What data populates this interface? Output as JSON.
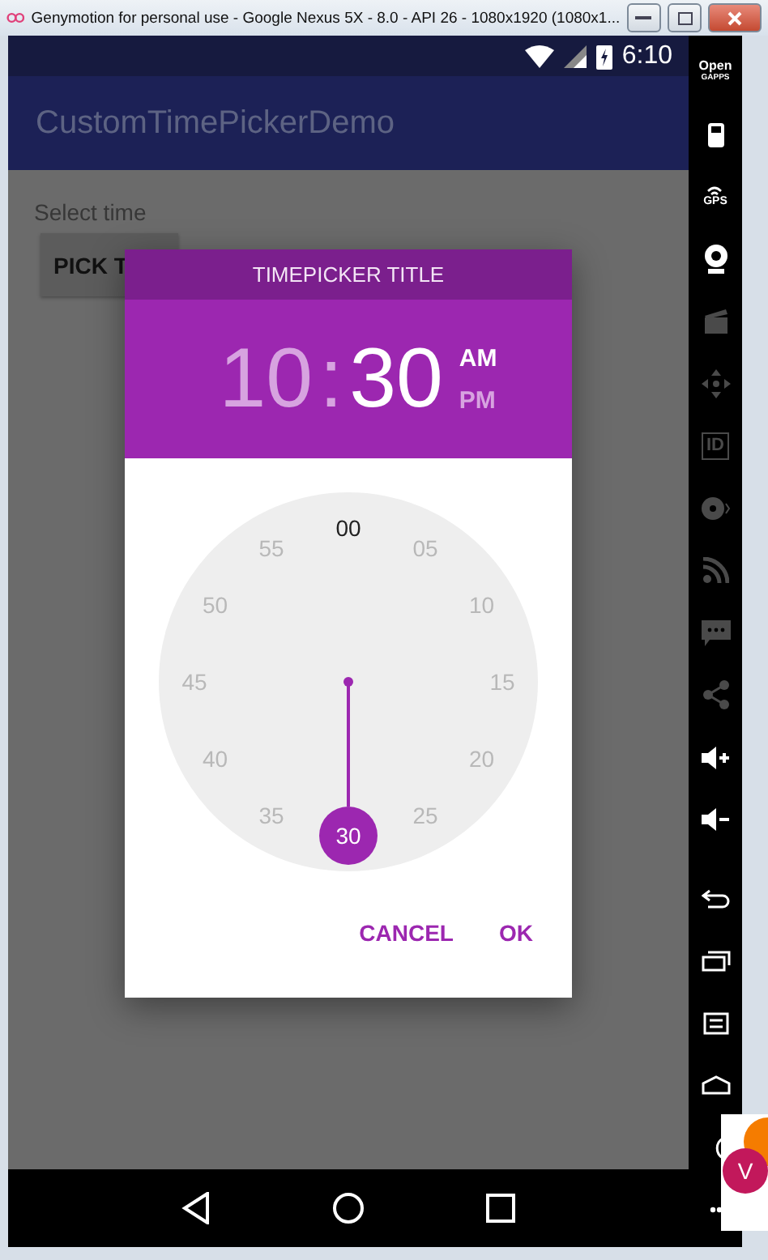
{
  "window": {
    "title": "Genymotion for personal use - Google Nexus 5X - 8.0 - API 26 - 1080x1920 (1080x1..."
  },
  "status_bar": {
    "time": "6:10"
  },
  "app_bar": {
    "title": "CustomTimePickerDemo"
  },
  "content": {
    "label": "Select time",
    "button": "PICK T"
  },
  "dialog": {
    "title": "TIMEPICKER TITLE",
    "hour": {
      "text": "10",
      "selected": false
    },
    "separator": ":",
    "minute": {
      "text": "30",
      "selected": true
    },
    "periods": [
      {
        "label": "AM",
        "selected": true
      },
      {
        "label": "PM",
        "selected": false
      }
    ],
    "dial": [
      {
        "label": "00",
        "selected": false,
        "dim": false
      },
      {
        "label": "05",
        "selected": false,
        "dim": true
      },
      {
        "label": "10",
        "selected": false,
        "dim": true
      },
      {
        "label": "15",
        "selected": false,
        "dim": true
      },
      {
        "label": "20",
        "selected": false,
        "dim": true
      },
      {
        "label": "25",
        "selected": false,
        "dim": true
      },
      {
        "label": "30",
        "selected": true,
        "dim": false
      },
      {
        "label": "35",
        "selected": false,
        "dim": true
      },
      {
        "label": "40",
        "selected": false,
        "dim": true
      },
      {
        "label": "45",
        "selected": false,
        "dim": true
      },
      {
        "label": "50",
        "selected": false,
        "dim": true
      },
      {
        "label": "55",
        "selected": false,
        "dim": true
      }
    ],
    "buttons": [
      "CANCEL",
      "OK"
    ]
  },
  "sidebar": {
    "items": [
      {
        "kind": "gapps",
        "label": "Open",
        "sublabel": "GAPPS",
        "disabled": false
      },
      {
        "kind": "battery",
        "disabled": false
      },
      {
        "kind": "gps",
        "label": "GPS",
        "disabled": false
      },
      {
        "kind": "webcam",
        "disabled": false
      },
      {
        "kind": "clapper",
        "disabled": true
      },
      {
        "kind": "dpad",
        "disabled": true
      },
      {
        "kind": "id",
        "label": "ID",
        "disabled": true
      },
      {
        "kind": "disc",
        "disabled": true
      },
      {
        "kind": "rss",
        "disabled": true
      },
      {
        "kind": "message",
        "disabled": true
      },
      {
        "kind": "share",
        "disabled": true
      },
      {
        "kind": "volume_up",
        "disabled": false
      },
      {
        "kind": "volume_down",
        "disabled": false
      },
      {
        "kind": "back",
        "disabled": false
      },
      {
        "kind": "recent",
        "disabled": false
      },
      {
        "kind": "menu",
        "disabled": false
      },
      {
        "kind": "home",
        "disabled": false
      },
      {
        "kind": "rotate",
        "disabled": false
      },
      {
        "kind": "more",
        "disabled": false
      }
    ]
  },
  "nav_bar": {
    "buttons": [
      {
        "kind": "back"
      },
      {
        "kind": "home"
      },
      {
        "kind": "recent"
      }
    ]
  },
  "overlay": {
    "avatar": "V"
  }
}
